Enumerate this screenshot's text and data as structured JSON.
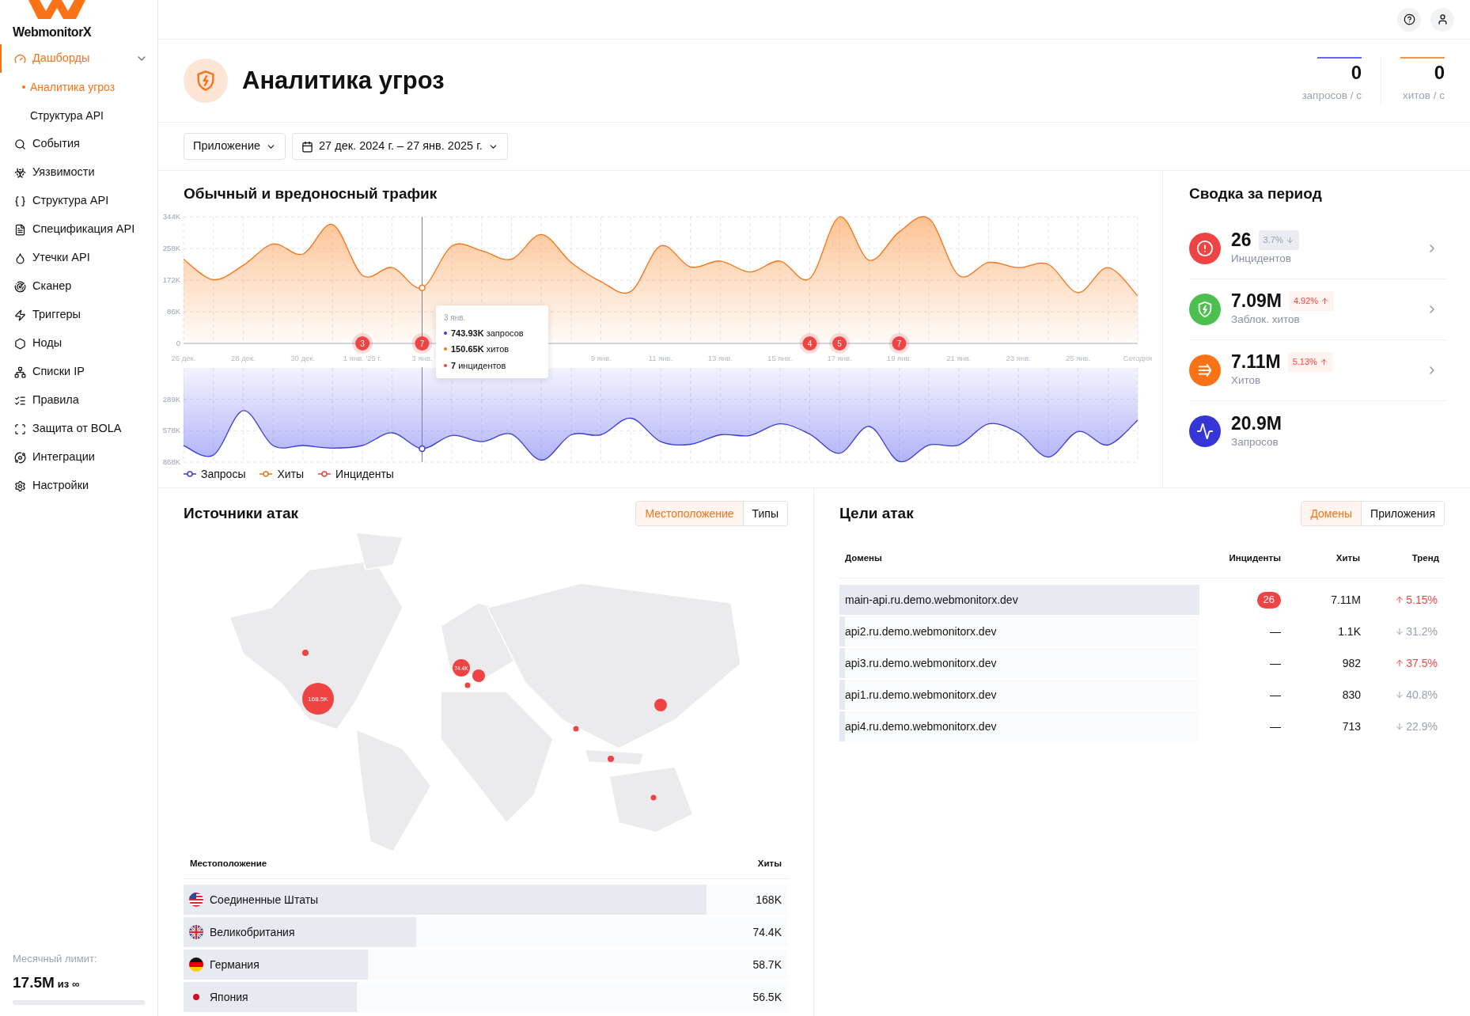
{
  "sidebar": {
    "logo": "WebmonitorX",
    "items": [
      {
        "label": "Дашборды",
        "selected": true,
        "expanded": true,
        "children": [
          {
            "label": "Аналитика угроз",
            "selected": true
          },
          {
            "label": "Структура API",
            "selected": false
          }
        ]
      },
      {
        "label": "События",
        "selected": false
      },
      {
        "label": "Уязвимости",
        "selected": false
      },
      {
        "label": "Структура API",
        "selected": false
      },
      {
        "label": "Спецификация API",
        "selected": false
      },
      {
        "label": "Утечки API",
        "selected": false
      },
      {
        "label": "Сканер",
        "selected": false
      },
      {
        "label": "Триггеры",
        "selected": false
      },
      {
        "label": "Ноды",
        "selected": false
      },
      {
        "label": "Списки IP",
        "selected": false
      },
      {
        "label": "Правила",
        "selected": false
      },
      {
        "label": "Защита от BOLA",
        "selected": false
      },
      {
        "label": "Интеграции",
        "selected": false
      },
      {
        "label": "Настройки",
        "selected": false
      }
    ],
    "limit": {
      "label": "Месячный лимит:",
      "value": "17.5M",
      "suffix": "из ∞"
    }
  },
  "page": {
    "title": "Аналитика угроз",
    "stats": [
      {
        "value": "0",
        "label": "запросов / с",
        "color": "#6366f1"
      },
      {
        "value": "0",
        "label": "хитов / с",
        "color": "#fb923c"
      }
    ],
    "filters": [
      {
        "kind": "select",
        "label": "Приложение"
      },
      {
        "kind": "date",
        "label": "27 дек. 2024 г. – 27 янв. 2025 г."
      }
    ]
  },
  "traffic": {
    "title": "Обычный и вредоносный трафик",
    "tooltip": {
      "title": "3 янв.",
      "lines": [
        {
          "text": "**743.93K** запросов",
          "color": "#3b3bdb"
        },
        {
          "text": "**150.65K** хитов",
          "color": "#f97316"
        },
        {
          "text": "**7** инцидентов",
          "color": "#ef4444"
        }
      ]
    },
    "incidents": {
      "name": "Инциденты",
      "color": "#ef4444",
      "markers": [
        {
          "count": "3"
        },
        {
          "count": "7"
        },
        {
          "count": "4"
        },
        {
          "count": "5"
        },
        {
          "count": "7"
        }
      ]
    },
    "hits_chart": {
      "chart_data": {
        "type": "area",
        "grid": true,
        "categories": [
          "26 дек.",
          null,
          "28 дек.",
          null,
          "30 дек.",
          null,
          "1 янв. '25 г.",
          null,
          "3 янв.",
          null,
          null,
          null,
          null,
          null,
          "9 янв.",
          null,
          "11 янв.",
          null,
          "13 янв.",
          null,
          "15 янв.",
          null,
          "17 янв.",
          null,
          "19 янв.",
          null,
          "21 янв.",
          null,
          "23 янв.",
          null,
          "25 янв.",
          null,
          "Сегодня"
        ],
        "ylim": [
          0,
          344000
        ],
        "yticks": [
          {
            "value": 344000,
            "label": "344K"
          },
          {
            "value": 258000,
            "label": "258K"
          },
          {
            "value": 172000,
            "label": "172K"
          },
          {
            "value": 86000,
            "label": "86K"
          },
          0
        ],
        "series": [
          {
            "name": "Хиты",
            "color": "#f97316",
            "values": [
              229000,
              173000,
              212000,
              270000,
              243000,
              323000,
              185000,
              206000,
              151000,
              265000,
              252000,
              229000,
              296000,
              220000,
              168000,
              141000,
              265000,
              208000,
              224000,
              194000,
              224000,
              176000,
              344000,
              226000,
              303000,
              339000,
              185000,
              220000,
              206000,
              215000,
              138000,
              206000,
              129000
            ]
          }
        ]
      }
    },
    "requests_chart": {
      "chart_data": {
        "type": "area",
        "grid": true,
        "categories": [
          null,
          null,
          null,
          null,
          null,
          null,
          null,
          null,
          null,
          null,
          null,
          null,
          null,
          null,
          null,
          null,
          null,
          null,
          null,
          null,
          null,
          null,
          null,
          null,
          null,
          null,
          null,
          null,
          null,
          null,
          null,
          null,
          null
        ],
        "ylim": [
          868000,
          0
        ],
        "yticks": [
          {
            "value": 289000,
            "label": "289K"
          },
          {
            "value": 578000,
            "label": "578K"
          },
          {
            "value": 868000,
            "label": "868K"
          }
        ],
        "series": [
          {
            "name": "Запросы",
            "color": "#3b3bdb",
            "values": [
              715000,
              803000,
              393000,
              715000,
              715000,
              739000,
              715000,
              598000,
              744000,
              622000,
              680000,
              610000,
              850000,
              616000,
              616000,
              463000,
              680000,
              704000,
              616000,
              622000,
              516000,
              610000,
              786000,
              540000,
              862000,
              710000,
              710000,
              516000,
              598000,
              821000,
              586000,
              710000,
              481000
            ]
          }
        ]
      }
    }
  },
  "summary": {
    "title": "Сводка за период",
    "items": [
      {
        "kind": "incidents",
        "color": "#ef4444",
        "value": "26",
        "label": "Инцидентов",
        "badge": {
          "text": "3.7%",
          "rising": false
        },
        "link": true
      },
      {
        "kind": "blocked",
        "color": "#4cc04f",
        "value": "7.09M",
        "label": "Заблок. хитов",
        "badge": {
          "text": "4.92%",
          "rising": true
        },
        "link": true
      },
      {
        "kind": "hits",
        "color": "#f97316",
        "value": "7.11M",
        "label": "Хитов",
        "badge": {
          "text": "5.13%",
          "rising": true
        },
        "link": true
      },
      {
        "kind": "requests",
        "color": "#3535d8",
        "value": "20.9M",
        "label": "Запросов",
        "link": false
      }
    ]
  },
  "sources": {
    "title": "Источники атак",
    "toggle": [
      {
        "label": "Местоположение",
        "selected": true
      },
      {
        "label": "Типы",
        "selected": false
      }
    ],
    "map": {
      "markers": [
        {
          "label": "168.5K"
        },
        {
          "label": "74.4K"
        }
      ]
    },
    "columns": [
      "Местоположение",
      "Хиты"
    ],
    "rows": [
      {
        "kind": "us",
        "name": "Соединенные Штаты",
        "hits": "168K",
        "level": 0.865
      },
      {
        "kind": "gb",
        "name": "Великобритания",
        "hits": "74.4K",
        "level": 0.385
      },
      {
        "kind": "de",
        "name": "Германия",
        "hits": "58.7K",
        "level": 0.305
      },
      {
        "kind": "jp",
        "name": "Япония",
        "hits": "56.5K",
        "level": 0.287
      }
    ]
  },
  "targets": {
    "title": "Цели атак",
    "toggle": [
      {
        "label": "Домены",
        "selected": true
      },
      {
        "label": "Приложения",
        "selected": false
      }
    ],
    "columns": [
      "Домены",
      "Инциденты",
      "Хиты",
      "Тренд"
    ],
    "rows": [
      {
        "domain": "main-api.ru.demo.webmonitorx.dev",
        "incidents": "26",
        "hits": "7.11M",
        "trend": "5.15%",
        "rising": true,
        "level": 1
      },
      {
        "domain": "api2.ru.demo.webmonitorx.dev",
        "incidents": "—",
        "hits": "1.1K",
        "trend": "31.2%",
        "rising": false,
        "level": 0.015
      },
      {
        "domain": "api3.ru.demo.webmonitorx.dev",
        "incidents": "—",
        "hits": "982",
        "trend": "37.5%",
        "rising": true,
        "level": 0.015
      },
      {
        "domain": "api1.ru.demo.webmonitorx.dev",
        "incidents": "—",
        "hits": "830",
        "trend": "40.8%",
        "rising": false,
        "level": 0.015
      },
      {
        "domain": "api4.ru.demo.webmonitorx.dev",
        "incidents": "—",
        "hits": "713",
        "trend": "22.9%",
        "rising": false,
        "level": 0.015
      }
    ]
  }
}
